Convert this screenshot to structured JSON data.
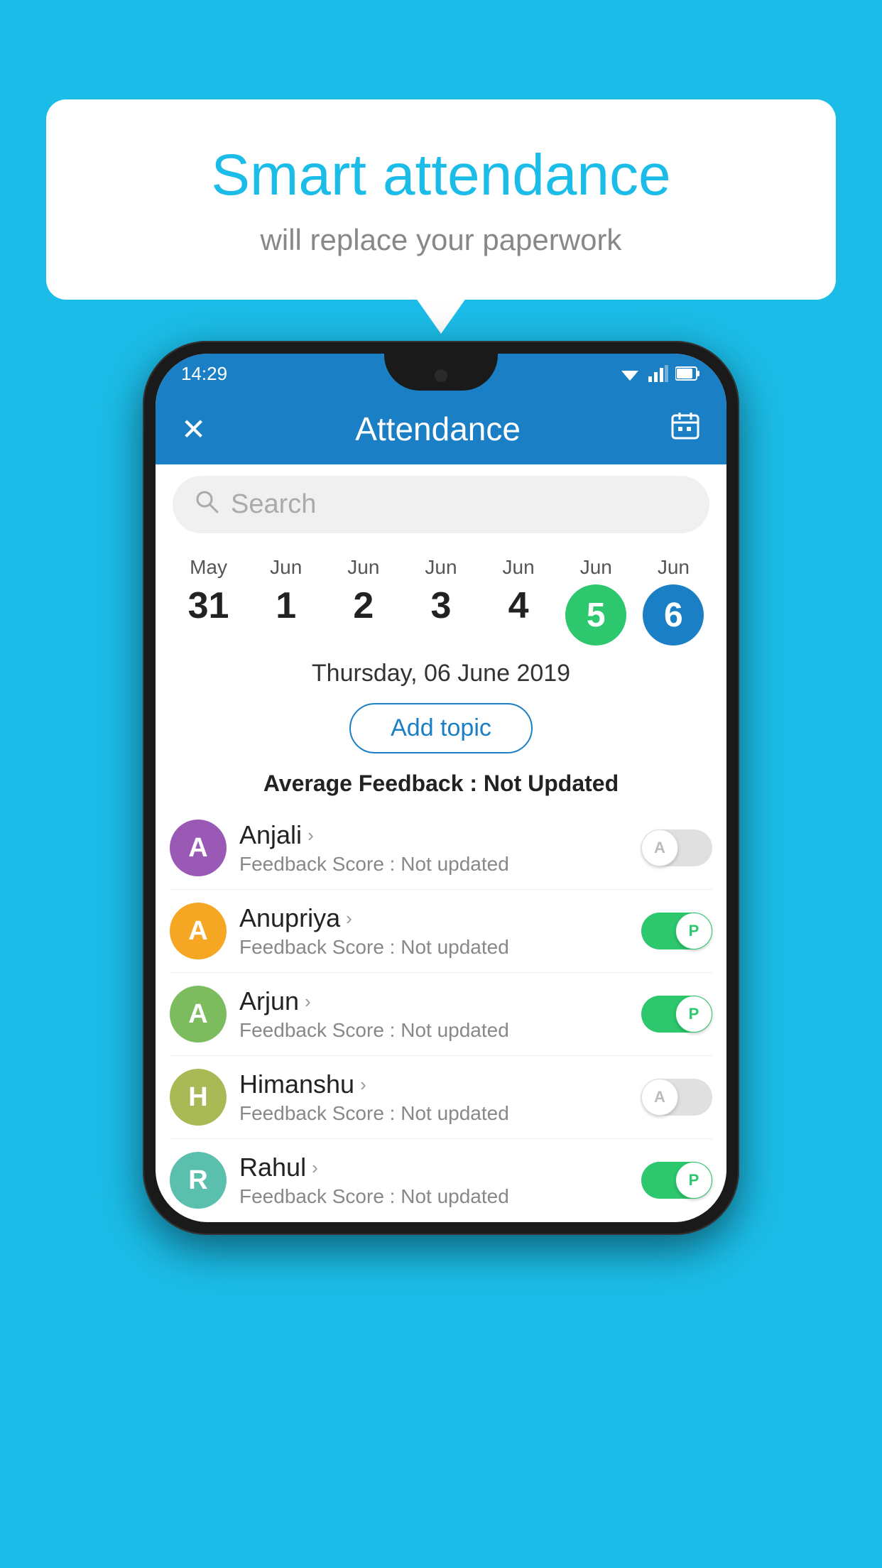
{
  "background_color": "#1BBDE8",
  "speech_bubble": {
    "title": "Smart attendance",
    "subtitle": "will replace your paperwork"
  },
  "status_bar": {
    "time": "14:29"
  },
  "app_bar": {
    "title": "Attendance",
    "back_icon": "✕",
    "calendar_icon": "📅"
  },
  "search": {
    "placeholder": "Search"
  },
  "calendar": {
    "days": [
      {
        "month": "May",
        "date": "31",
        "highlight": null
      },
      {
        "month": "Jun",
        "date": "1",
        "highlight": null
      },
      {
        "month": "Jun",
        "date": "2",
        "highlight": null
      },
      {
        "month": "Jun",
        "date": "3",
        "highlight": null
      },
      {
        "month": "Jun",
        "date": "4",
        "highlight": null
      },
      {
        "month": "Jun",
        "date": "5",
        "highlight": "green"
      },
      {
        "month": "Jun",
        "date": "6",
        "highlight": "blue"
      }
    ],
    "selected_date": "Thursday, 06 June 2019"
  },
  "add_topic_label": "Add topic",
  "avg_feedback_label": "Average Feedback : ",
  "avg_feedback_value": "Not Updated",
  "students": [
    {
      "name": "Anjali",
      "avatar_letter": "A",
      "avatar_color": "purple",
      "feedback": "Feedback Score : Not updated",
      "toggle_state": "off"
    },
    {
      "name": "Anupriya",
      "avatar_letter": "A",
      "avatar_color": "yellow",
      "feedback": "Feedback Score : Not updated",
      "toggle_state": "on"
    },
    {
      "name": "Arjun",
      "avatar_letter": "A",
      "avatar_color": "green_light",
      "feedback": "Feedback Score : Not updated",
      "toggle_state": "on"
    },
    {
      "name": "Himanshu",
      "avatar_letter": "H",
      "avatar_color": "olive",
      "feedback": "Feedback Score : Not updated",
      "toggle_state": "off"
    },
    {
      "name": "Rahul",
      "avatar_letter": "R",
      "avatar_color": "teal",
      "feedback": "Feedback Score : Not updated",
      "toggle_state": "on"
    }
  ]
}
